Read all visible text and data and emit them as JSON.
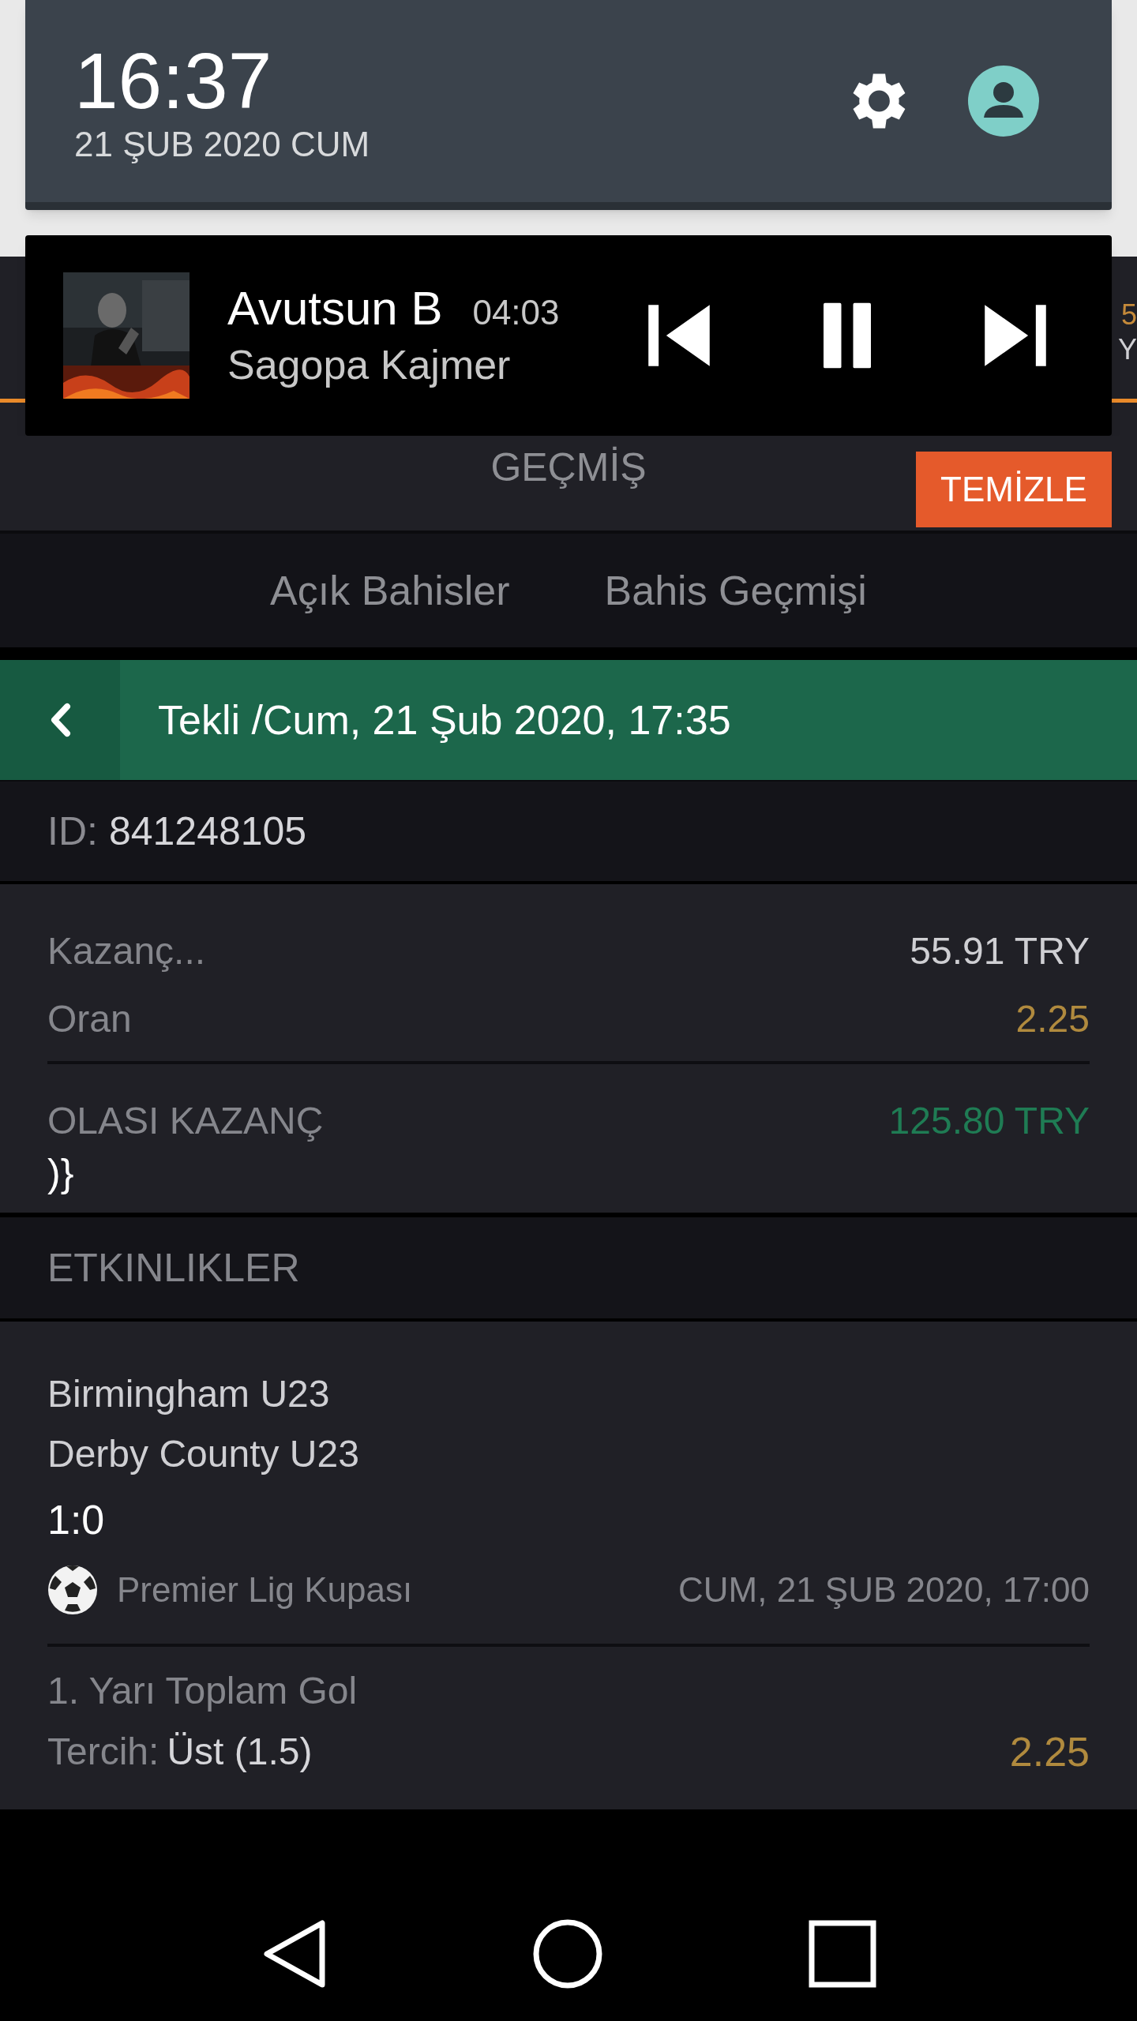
{
  "status_panel": {
    "time": "16:37",
    "date": "21 ŞUB 2020 CUM"
  },
  "media": {
    "title": "Avutsun B",
    "duration": "04:03",
    "artist": "Sagopa Kajmer",
    "playing": true
  },
  "app_header": {
    "fragments": [
      "5",
      "Y"
    ]
  },
  "history": {
    "title": "GEÇMİŞ",
    "clear_button": "TEMİZLE"
  },
  "tabs": [
    {
      "label": "Açık Bahisler"
    },
    {
      "label": "Bahis Geçmişi"
    }
  ],
  "bet": {
    "title": "Tekli /Cum, 21 Şub 2020, 17:35",
    "id_label": "ID:",
    "id": "841248105",
    "rows": [
      {
        "label": "Kazanç...",
        "value": "55.91 TRY",
        "kind": "plain"
      },
      {
        "label": "Oran",
        "value": "2.25",
        "kind": "odds"
      }
    ],
    "potential": {
      "label": "OLASI KAZANÇ",
      "value": "125.80 TRY"
    },
    "stray": ")}"
  },
  "events": {
    "title": "ETKINLIKLER",
    "items": [
      {
        "home": "Birmingham U23",
        "away": "Derby County U23",
        "score": "1:0",
        "league": "Premier Lig Kupası",
        "date": "CUM, 21 ŞUB 2020, 17:00",
        "market": "1. Yarı Toplam Gol",
        "choice_label": "Tercih:",
        "choice": "Üst (1.5)",
        "odds": "2.25"
      }
    ]
  }
}
